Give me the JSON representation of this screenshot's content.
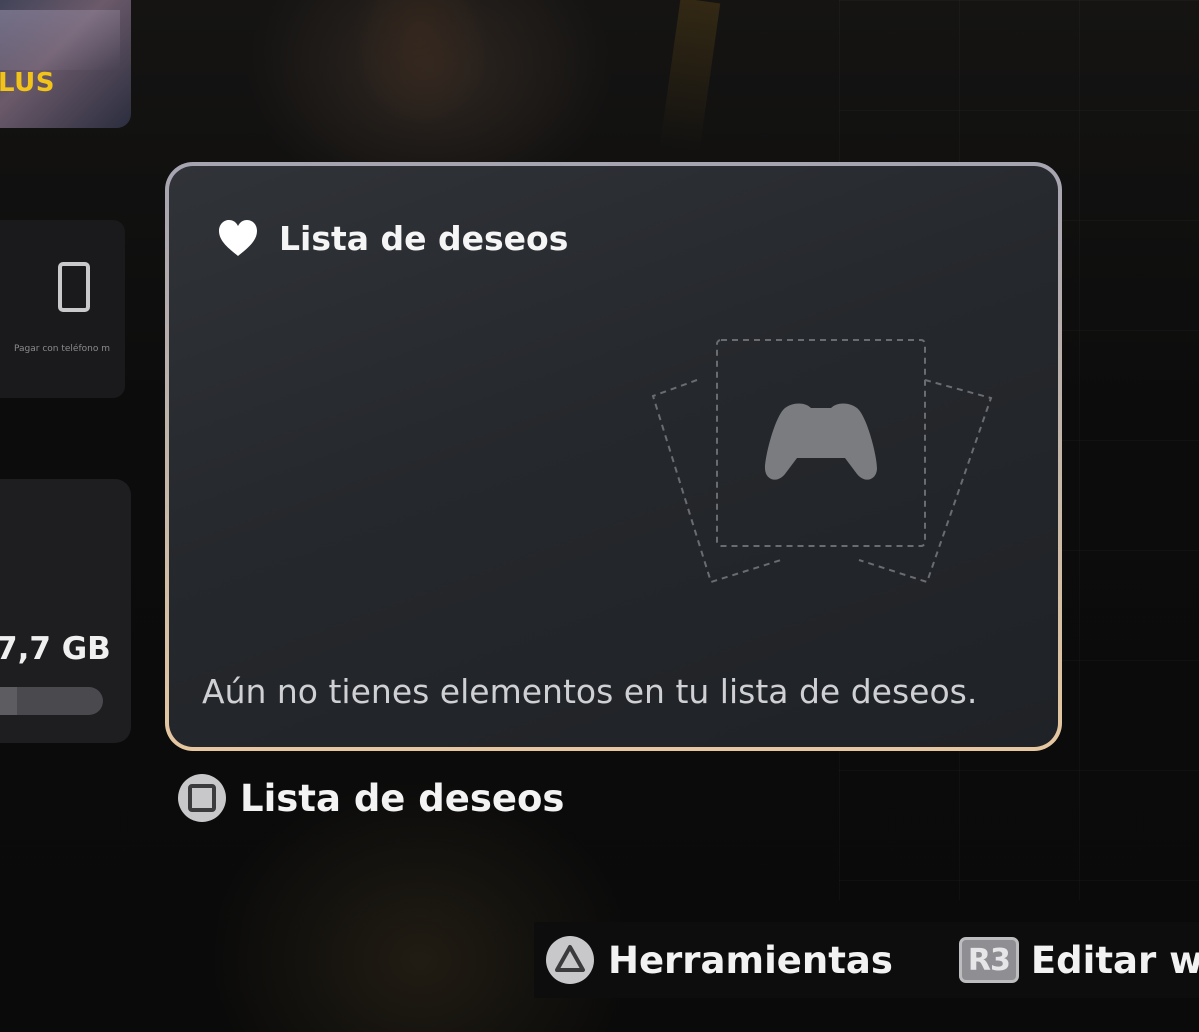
{
  "left_widgets": {
    "plus_label": "LUS",
    "pay_text": "Pagar con teléfono m",
    "storage_value": "7,7 GB",
    "storage_fill_fraction": 0.3
  },
  "wishlist_card": {
    "title": "Lista de deseos",
    "empty_message": "Aún no tienes elementos en tu lista de deseos."
  },
  "caption": {
    "label": "Lista de deseos"
  },
  "hints": {
    "tools_label": "Herramientas",
    "r3_badge": "R3",
    "edit_label": "Editar wid"
  },
  "icons": {
    "card_title_icon": "heart-icon",
    "placeholder": "controller-icon",
    "caption_button": "square-button-icon",
    "tools_button": "triangle-button-icon",
    "edit_button": "r3-button-icon"
  },
  "colors": {
    "plus_brand": "#f2c318",
    "card_border_top": "#a7a4b2",
    "card_border_bottom": "#e6c7a0"
  }
}
